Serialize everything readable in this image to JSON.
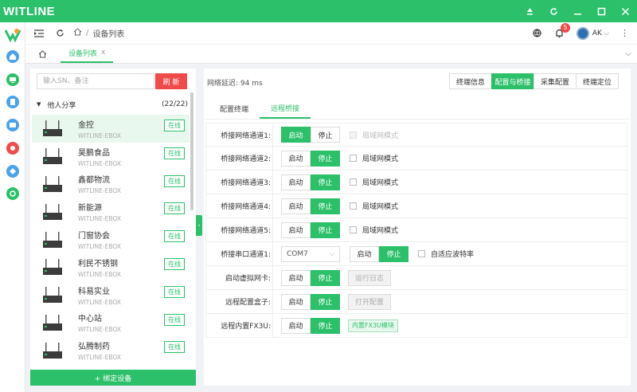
{
  "app": {
    "title": "WITLINE"
  },
  "nav": {
    "breadcrumb_sep": "/",
    "breadcrumb_page": "设备列表",
    "notification_count": "5",
    "user": "AK"
  },
  "tabs": {
    "active_label": "设备列表",
    "close": "x"
  },
  "devices": {
    "search_placeholder": "输入SN、备注",
    "refresh_label": "刷 新",
    "group_name": "他人分享",
    "group_count": "(22/22)",
    "add_label": "+ 绑定设备",
    "items": [
      {
        "name": "金控",
        "model": "WITLINE-EBOX",
        "status": "在线"
      },
      {
        "name": "昊鹏食品",
        "model": "WITLINE-EBOX",
        "status": "在线"
      },
      {
        "name": "鑫都物流",
        "model": "WITLINE-EBOX",
        "status": "在线"
      },
      {
        "name": "新能源",
        "model": "WITLINE-EBOX",
        "status": "在线"
      },
      {
        "name": "门窗协会",
        "model": "WITLINE-EBOX",
        "status": "在线"
      },
      {
        "name": "利民不锈钢",
        "model": "WITLINE-EBOX",
        "status": "在线"
      },
      {
        "name": "科易实业",
        "model": "WITLINE-EBOX",
        "status": "在线"
      },
      {
        "name": "中心站",
        "model": "WITLINE-EBOX",
        "status": "在线"
      },
      {
        "name": "弘腾制药",
        "model": "WITLINE-EBOX",
        "status": "在线"
      }
    ]
  },
  "main": {
    "latency": "网络延迟: 94 ms",
    "buttons": [
      "终端信息",
      "配置与桥接",
      "采集配置",
      "终端定位"
    ],
    "subtabs": [
      "配置终端",
      "远程桥接"
    ],
    "start": "启动",
    "stop": "停止",
    "lan_mode": "局域网模式",
    "rows": {
      "bridge1": "桥接网络通道1:",
      "bridge2": "桥接网络通道2:",
      "bridge3": "桥接网络通道3:",
      "bridge4": "桥接网络通道4:",
      "bridge5": "桥接网络通道5:",
      "serial": "桥接串口通道1:",
      "vnic": "启动虚拟网卡:",
      "remote_box": "远程配置盒子:",
      "fx3u": "远程内置FX3U:"
    },
    "com_value": "COM7",
    "auto_baud": "自适应波特率",
    "run_log": "运行日志",
    "open_config": "打开配置",
    "fx3u_module": "内置FX3U模块"
  },
  "colors": {
    "accent": "#2cc06a",
    "danger": "#f04a4a",
    "rail_icon": "#4aa3e8"
  }
}
